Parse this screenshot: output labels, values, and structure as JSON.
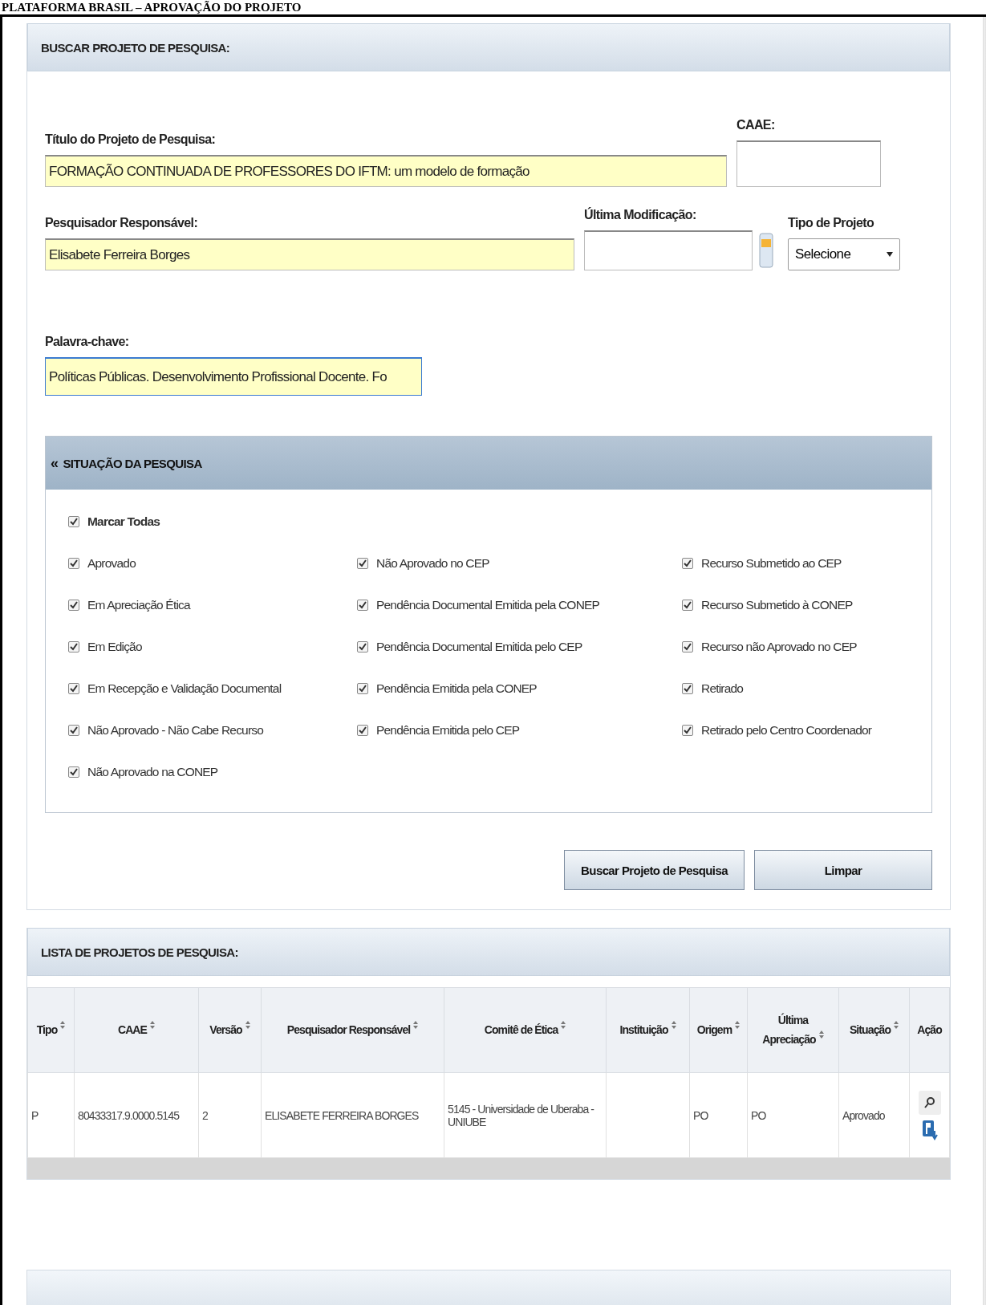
{
  "page_title": "PLATAFORMA BRASIL – APROVAÇÃO DO PROJETO",
  "search_panel": {
    "title": "BUSCAR PROJETO DE PESQUISA:",
    "fields": {
      "titulo": {
        "label": "Título do Projeto de Pesquisa:",
        "value": "FORMAÇÃO CONTINUADA DE PROFESSORES DO IFTM:  um modelo de formação"
      },
      "caae": {
        "label": "CAAE:"
      },
      "pesquisador": {
        "label": "Pesquisador Responsável:",
        "value": "Elisabete Ferreira Borges"
      },
      "ultima_modificacao": {
        "label": "Última Modificação:"
      },
      "tipo_projeto": {
        "label": "Tipo de Projeto",
        "value": "Selecione"
      },
      "palavra_chave": {
        "label": "Palavra-chave:",
        "value": "Políticas Públicas. Desenvolvimento Profissional Docente. Fo"
      }
    },
    "situacao": {
      "title": "SITUAÇÃO DA PESQUISA",
      "collapse_glyph": "«",
      "expanded": true,
      "select_all": {
        "label": "Marcar Todas",
        "checked": true
      },
      "columns": [
        [
          {
            "label": "Aprovado",
            "checked": true
          },
          {
            "label": "Em Apreciação Ética",
            "checked": true
          },
          {
            "label": "Em Edição",
            "checked": true
          },
          {
            "label": "Em Recepção e Validação Documental",
            "checked": true
          },
          {
            "label": "Não Aprovado - Não Cabe Recurso",
            "checked": true
          },
          {
            "label": "Não Aprovado na CONEP",
            "checked": true
          }
        ],
        [
          {
            "label": "Não Aprovado no CEP",
            "checked": true
          },
          {
            "label": "Pendência Documental Emitida pela CONEP",
            "checked": true
          },
          {
            "label": "Pendência Documental Emitida pelo CEP",
            "checked": true
          },
          {
            "label": "Pendência Emitida pela CONEP",
            "checked": true
          },
          {
            "label": "Pendência Emitida pelo CEP",
            "checked": true
          }
        ],
        [
          {
            "label": "Recurso Submetido ao CEP",
            "checked": true
          },
          {
            "label": "Recurso Submetido à CONEP",
            "checked": true
          },
          {
            "label": "Recurso não Aprovado no CEP",
            "checked": true
          },
          {
            "label": "Retirado",
            "checked": true
          },
          {
            "label": "Retirado pelo Centro Coordenador",
            "checked": true
          }
        ]
      ]
    },
    "buttons": [
      "Buscar Projeto de Pesquisa",
      "Limpar"
    ]
  },
  "list_panel": {
    "title": "LISTA DE PROJETOS DE PESQUISA:",
    "columns": [
      {
        "label": "Tipo",
        "sortable": true
      },
      {
        "label": "CAAE",
        "sortable": true
      },
      {
        "label": "Versão",
        "sortable": true
      },
      {
        "label": "Pesquisador Responsável",
        "sortable": true
      },
      {
        "label": "Comitê de Ética",
        "sortable": true
      },
      {
        "label": "Instituição",
        "sortable": true
      },
      {
        "label": "Origem",
        "sortable": true
      },
      {
        "label": "Última Apreciação",
        "sortable": true
      },
      {
        "label": "Situação",
        "sortable": true
      },
      {
        "label": "Ação",
        "sortable": false
      }
    ],
    "rows": [
      {
        "cells": [
          "P",
          "80433317.9.0000.5145",
          "2",
          "ELISABETE FERREIRA BORGES",
          "5145 - Universidade de Uberaba - UNIUBE",
          "",
          "PO",
          "PO",
          "Aprovado"
        ]
      }
    ]
  }
}
